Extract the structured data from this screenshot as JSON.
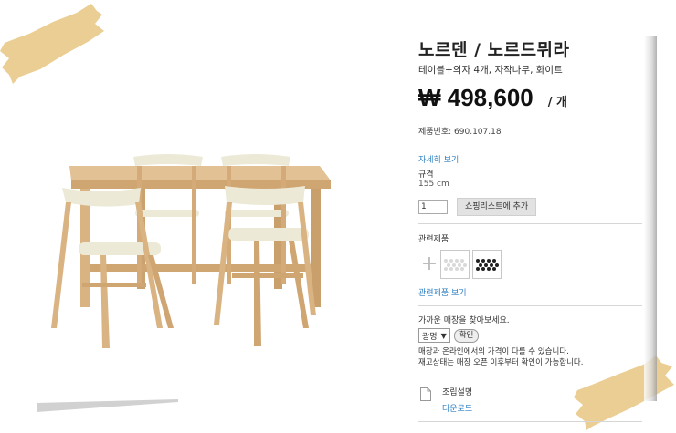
{
  "product": {
    "title": "노르덴 / 노르드뮈라",
    "subtitle": "테이블+의자 4개, 자작나무, 화이트",
    "price": "₩ 498,600",
    "unit": "/ 개",
    "article_label": "제품번호:",
    "article_number": "690.107.18"
  },
  "details": {
    "link": "자세히 보기",
    "spec_label": "규격",
    "spec_value": "155 cm"
  },
  "cart": {
    "quantity": "1",
    "button_label": "쇼핑리스트에 추가"
  },
  "related": {
    "title": "관련제품",
    "link": "관련제품 보기"
  },
  "store": {
    "label": "가까운 매장을 찾아보세요.",
    "selected": "광명",
    "ok_label": "확인",
    "note_line1": "매장과 온라인에서의 가격이 다를 수 있습니다.",
    "note_line2": "재고상태는 매장 오픈 이후부터 확인이 가능합니다."
  },
  "assembly": {
    "title": "조립설명",
    "download": "다운로드"
  },
  "colors": {
    "link": "#2d7fc1",
    "tape": "#e9c987",
    "wood": "#d9b382",
    "seat": "#ece9d6"
  }
}
